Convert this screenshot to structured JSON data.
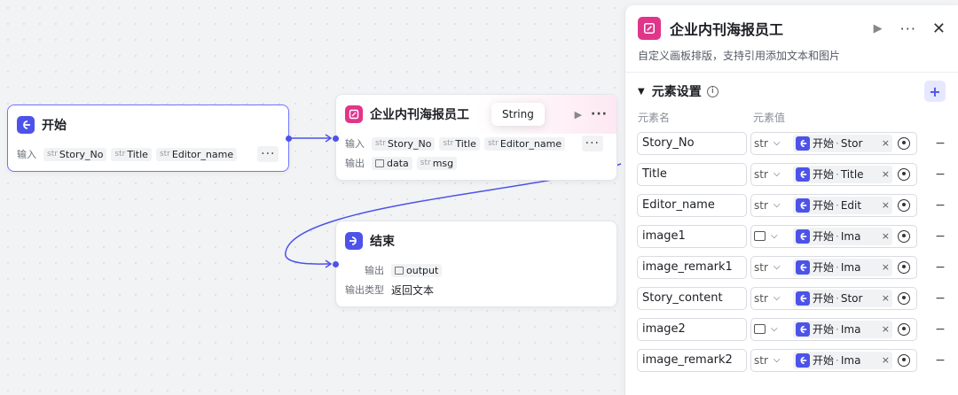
{
  "start_node": {
    "title": "开始",
    "input_label": "输入",
    "inputs": [
      {
        "type": "str",
        "name": "Story_No"
      },
      {
        "type": "str",
        "name": "Title"
      },
      {
        "type": "str",
        "name": "Editor_name"
      }
    ],
    "more": "···"
  },
  "poster_node": {
    "title": "企业内刊海报员工",
    "input_label": "输入",
    "output_label": "输出",
    "inputs": [
      {
        "type": "str",
        "name": "Story_No"
      },
      {
        "type": "str",
        "name": "Title"
      },
      {
        "type": "str",
        "name": "Editor_name"
      }
    ],
    "outputs": [
      {
        "type": "img",
        "name": "data"
      },
      {
        "type": "str",
        "name": "msg"
      }
    ],
    "tooltip": "String",
    "more": "···"
  },
  "end_node": {
    "title": "结束",
    "output_label": "输出",
    "output_var": "output",
    "output_type_label": "输出类型",
    "output_type_value": "返回文本"
  },
  "panel": {
    "title": "企业内刊海报员工",
    "description": "自定义画板排版，支持引用添加文本和图片",
    "section_title": "元素设置",
    "col_name": "元素名",
    "col_value": "元素值",
    "rows": [
      {
        "name": "Story_No",
        "type": "str",
        "ref_src": "开始",
        "ref_var": "Stor"
      },
      {
        "name": "Title",
        "type": "str",
        "ref_src": "开始",
        "ref_var": "Title"
      },
      {
        "name": "Editor_name",
        "type": "str",
        "ref_src": "开始",
        "ref_var": "Edit"
      },
      {
        "name": "image1",
        "type": "img",
        "ref_src": "开始",
        "ref_var": "Ima"
      },
      {
        "name": "image_remark1",
        "type": "str",
        "ref_src": "开始",
        "ref_var": "Ima"
      },
      {
        "name": "Story_content",
        "type": "str",
        "ref_src": "开始",
        "ref_var": "Stor"
      },
      {
        "name": "image2",
        "type": "img",
        "ref_src": "开始",
        "ref_var": "Ima"
      },
      {
        "name": "image_remark2",
        "type": "str",
        "ref_src": "开始",
        "ref_var": "Ima"
      }
    ]
  },
  "colors": {
    "accent": "#4d53e8",
    "poster": "#e0358a",
    "link": "#4d53e8"
  }
}
